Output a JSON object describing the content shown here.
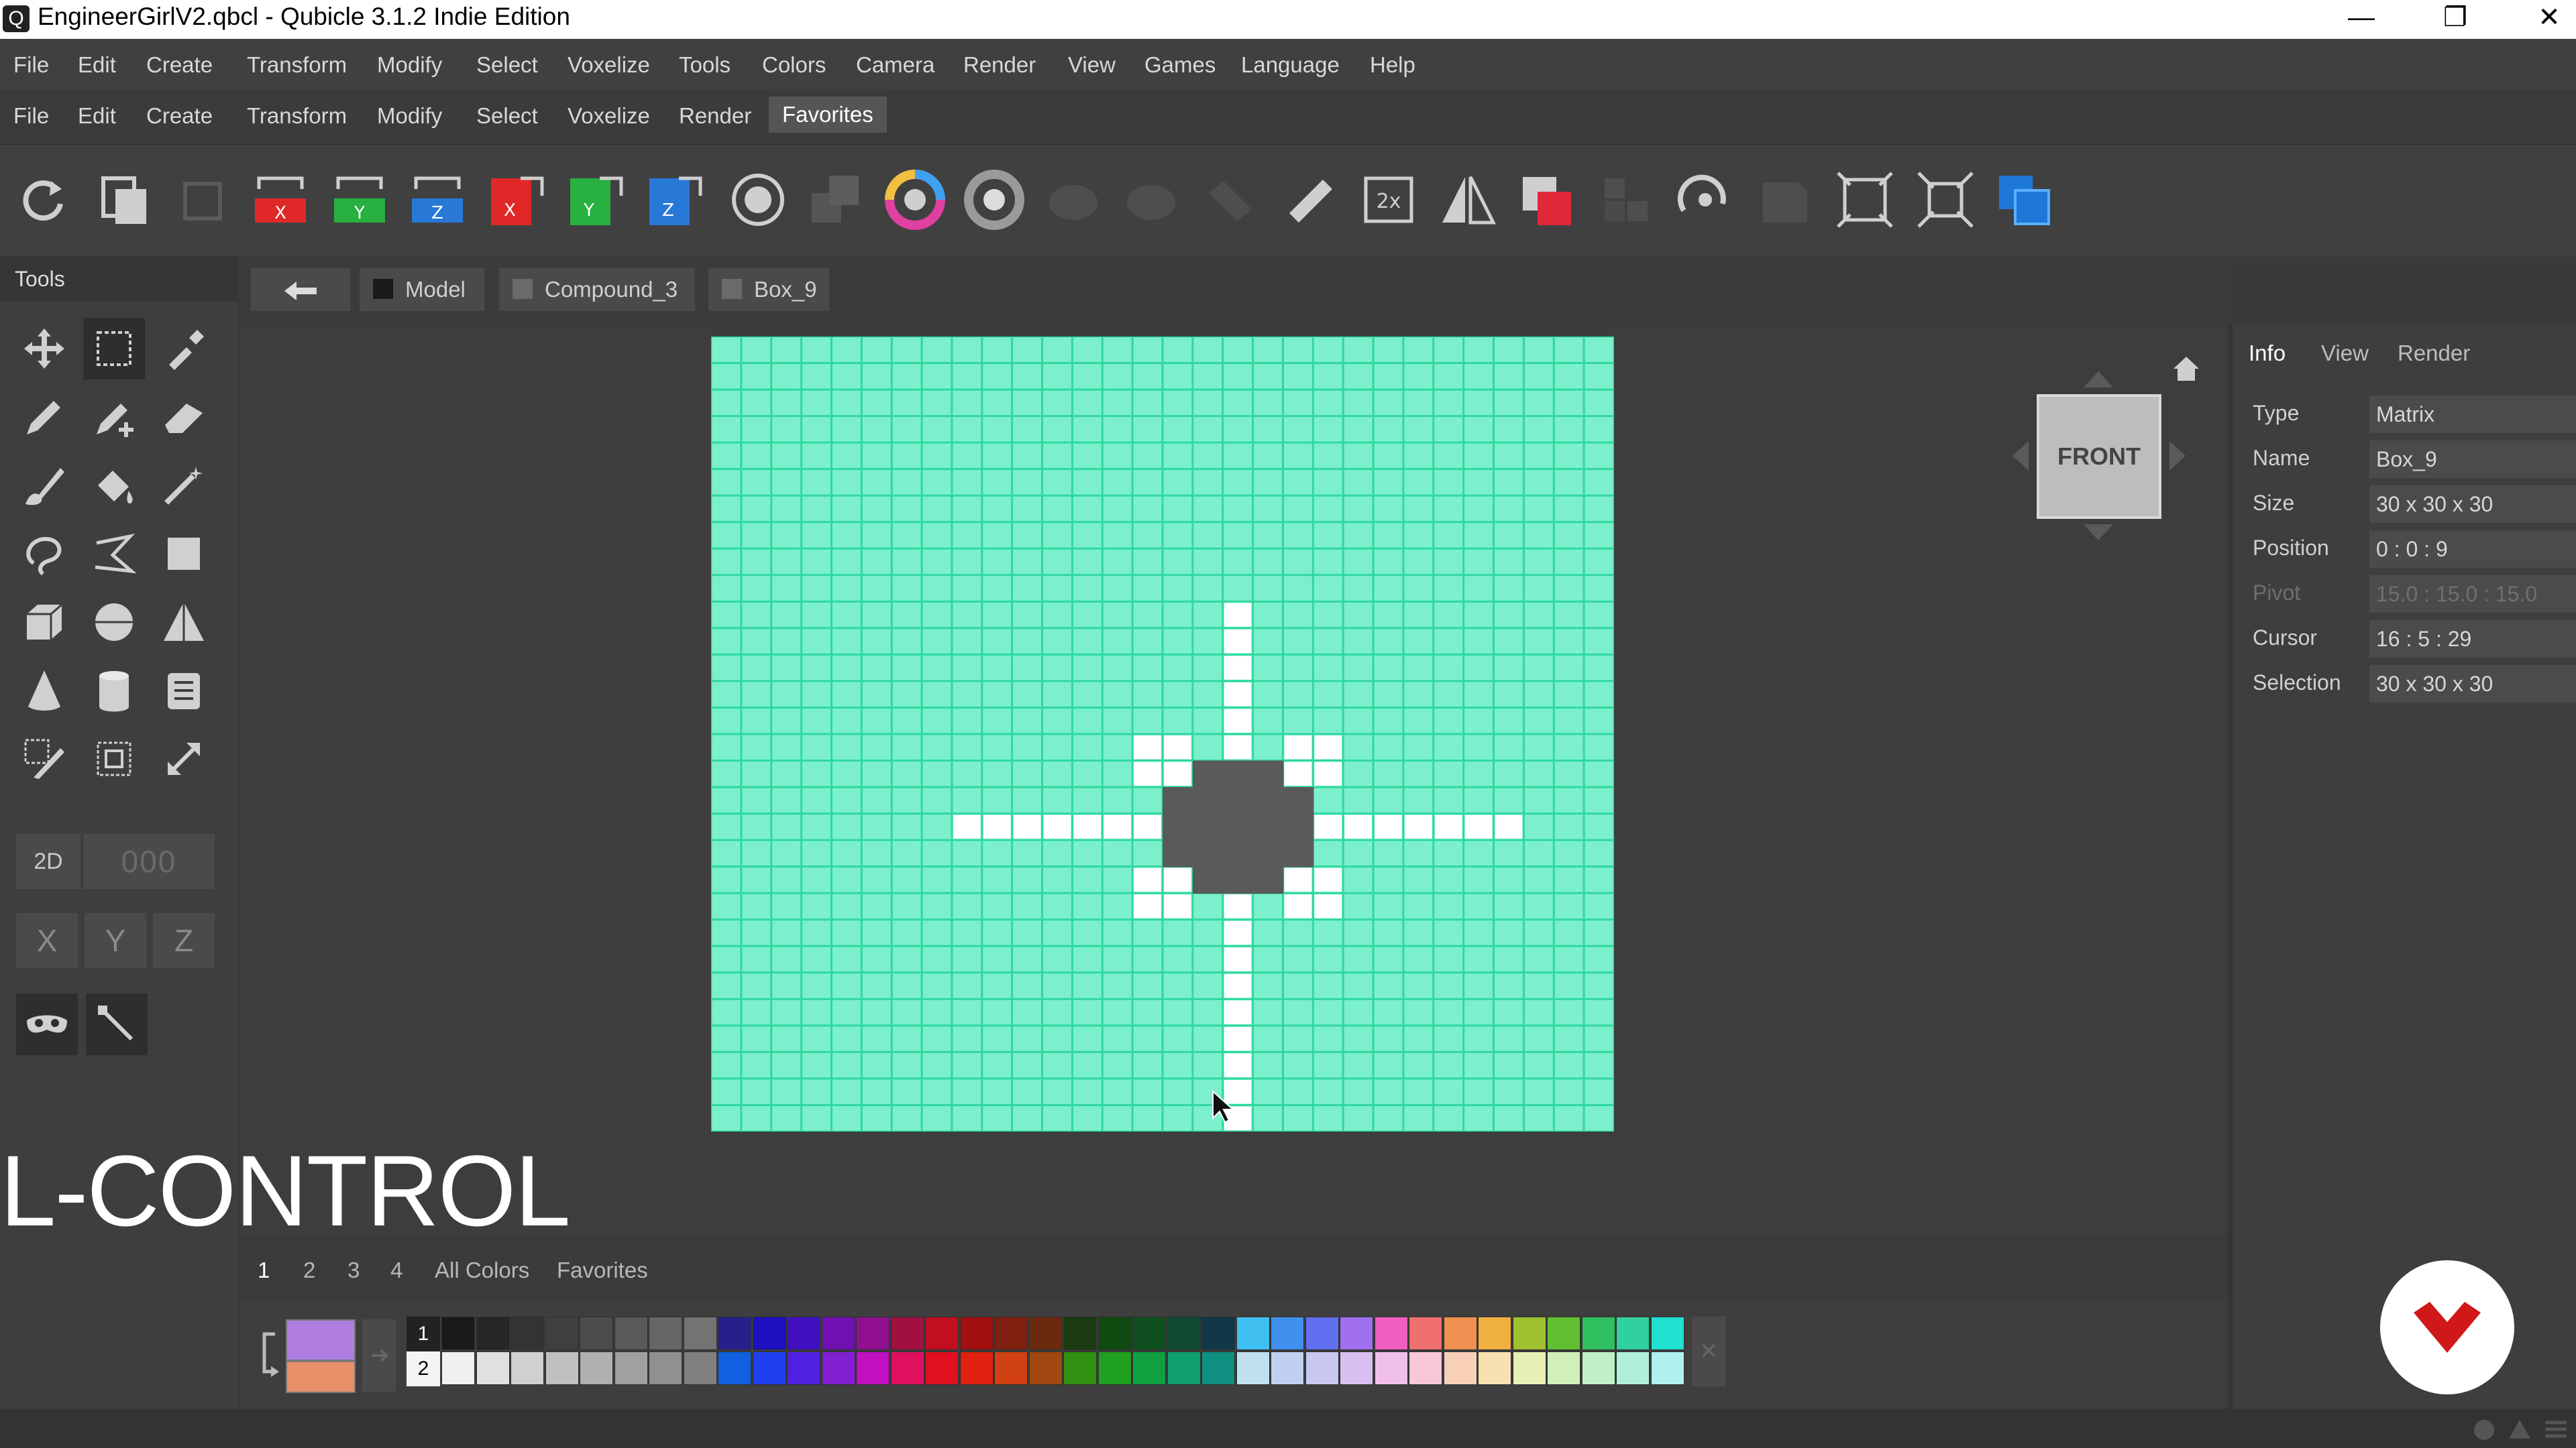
{
  "window": {
    "title": "EngineerGirlV2.qbcl - Qubicle 3.1.2 Indie Edition",
    "app_icon": "qubicle-icon",
    "controls": [
      "minimize-icon",
      "restore-icon",
      "close-icon"
    ]
  },
  "main_menu": [
    "File",
    "Edit",
    "Create",
    "Transform",
    "Modify",
    "Select",
    "Voxelize",
    "Tools",
    "Colors",
    "Camera",
    "Render",
    "View",
    "Games",
    "Language",
    "Help"
  ],
  "ribbon_menu": {
    "items": [
      "File",
      "Edit",
      "Create",
      "Transform",
      "Modify",
      "Select",
      "Voxelize",
      "Render"
    ],
    "active": "Favorites"
  },
  "tools_panel": {
    "title": "Tools",
    "mode_2d": "2D",
    "mode_3d": "000",
    "axes": [
      "X",
      "Y",
      "Z"
    ]
  },
  "breadcrumb": {
    "back_icon": "back-arrow-icon",
    "items": [
      "Model",
      "Compound_3",
      "Box_9"
    ]
  },
  "nav_cube": {
    "label": "FRONT"
  },
  "info_panel": {
    "tabs": [
      "Info",
      "View",
      "Render"
    ],
    "active_tab": "Info",
    "rows": [
      {
        "label": "Type",
        "value": "Matrix"
      },
      {
        "label": "Name",
        "value": "Box_9"
      },
      {
        "label": "Size",
        "value": "30 x 30 x 30"
      },
      {
        "label": "Position",
        "value": "0 : 0 : 9"
      },
      {
        "label": "Pivot",
        "value": "15.0 : 15.0 : 15.0"
      },
      {
        "label": "Cursor",
        "value": "16 : 5 : 29"
      },
      {
        "label": "Selection",
        "value": "30 x 30 x 30"
      }
    ]
  },
  "overlay_key": "L-CONTROL",
  "palette": {
    "tabs": [
      "1",
      "2",
      "3",
      "4",
      "All Colors",
      "Favorites"
    ],
    "active_tab": "1",
    "row_labels": [
      "1",
      "2"
    ],
    "primary_color": "#b07ee0",
    "secondary_color": "#e8906a",
    "row1": [
      "#1a1a1a",
      "#262626",
      "#333333",
      "#3f3f3f",
      "#4c4c4c",
      "#595959",
      "#666666",
      "#737373",
      "#28208a",
      "#1c10c0",
      "#4010c0",
      "#7010b0",
      "#901090",
      "#a01040",
      "#c01020",
      "#a01010",
      "#802010",
      "#6a2a10",
      "#1a3a10",
      "#104a10",
      "#105020",
      "#104a30",
      "#103848",
      "#40c0f0",
      "#4090f0",
      "#6070f0",
      "#a070f0",
      "#f060c0",
      "#f07070",
      "#f09050",
      "#f0b040",
      "#a0c030",
      "#60c030",
      "#30c060",
      "#30d0a0",
      "#20e0d0"
    ],
    "row2": [
      "#f0f0f0",
      "#e0e0e0",
      "#d0d0d0",
      "#c0c0c0",
      "#b0b0b0",
      "#a0a0a0",
      "#909090",
      "#808080",
      "#1060e0",
      "#2040f0",
      "#5020e0",
      "#8020d0",
      "#c010c0",
      "#e01060",
      "#e01020",
      "#e02010",
      "#d04010",
      "#a04810",
      "#309010",
      "#20a020",
      "#10a040",
      "#10a070",
      "#109080",
      "#c0e0f0",
      "#c0d0f0",
      "#c8c8f0",
      "#d8c0f0",
      "#f0c0e8",
      "#f8c8d8",
      "#f8d0b8",
      "#f8e0b0",
      "#e8f0b8",
      "#d0f0b8",
      "#c0f0c8",
      "#b0f0d8",
      "#b0f0f0"
    ]
  },
  "canvas": {
    "grid_color": "#8ff5d5",
    "cells": 30
  }
}
